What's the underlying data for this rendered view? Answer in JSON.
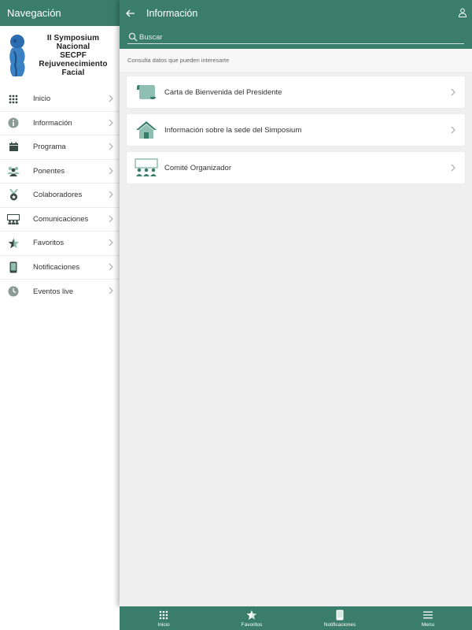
{
  "sidebar": {
    "title": "Navegación",
    "logo_text": [
      "II Symposium Nacional",
      "SECPF",
      "Rejuvenecimiento",
      "Facial"
    ],
    "items": [
      {
        "label": "Inicio",
        "icon": "grid-icon"
      },
      {
        "label": "Información",
        "icon": "info-icon"
      },
      {
        "label": "Programa",
        "icon": "calendar-icon"
      },
      {
        "label": "Ponentes",
        "icon": "people-icon"
      },
      {
        "label": "Colaboradores",
        "icon": "medal-icon"
      },
      {
        "label": "Comunicaciones",
        "icon": "presentation-icon"
      },
      {
        "label": "Favoritos",
        "icon": "star-icon"
      },
      {
        "label": "Notificaciones",
        "icon": "phone-icon"
      },
      {
        "label": "Eventos live",
        "icon": "clock-icon"
      }
    ]
  },
  "header": {
    "title": "Información"
  },
  "search": {
    "placeholder": "Buscar"
  },
  "subtitle": "Consulta datos que pueden interesarte",
  "cards": [
    {
      "label": "Carta de Bienvenida del Presidente",
      "icon": "scroll-icon"
    },
    {
      "label": "Información sobre la sede del Simposium",
      "icon": "house-icon"
    },
    {
      "label": "Comité Organizador",
      "icon": "committee-icon"
    }
  ],
  "bottom_nav": [
    {
      "label": "Inicio",
      "icon": "grid-icon"
    },
    {
      "label": "Favoritos",
      "icon": "star-icon"
    },
    {
      "label": "Notificaciones",
      "icon": "phone-icon"
    },
    {
      "label": "Menu",
      "icon": "hamburger-icon"
    }
  ],
  "colors": {
    "primary": "#3a7d6a",
    "icon_dark": "#3a4a45",
    "icon_light": "#8fbfb0",
    "background": "#efefef"
  }
}
